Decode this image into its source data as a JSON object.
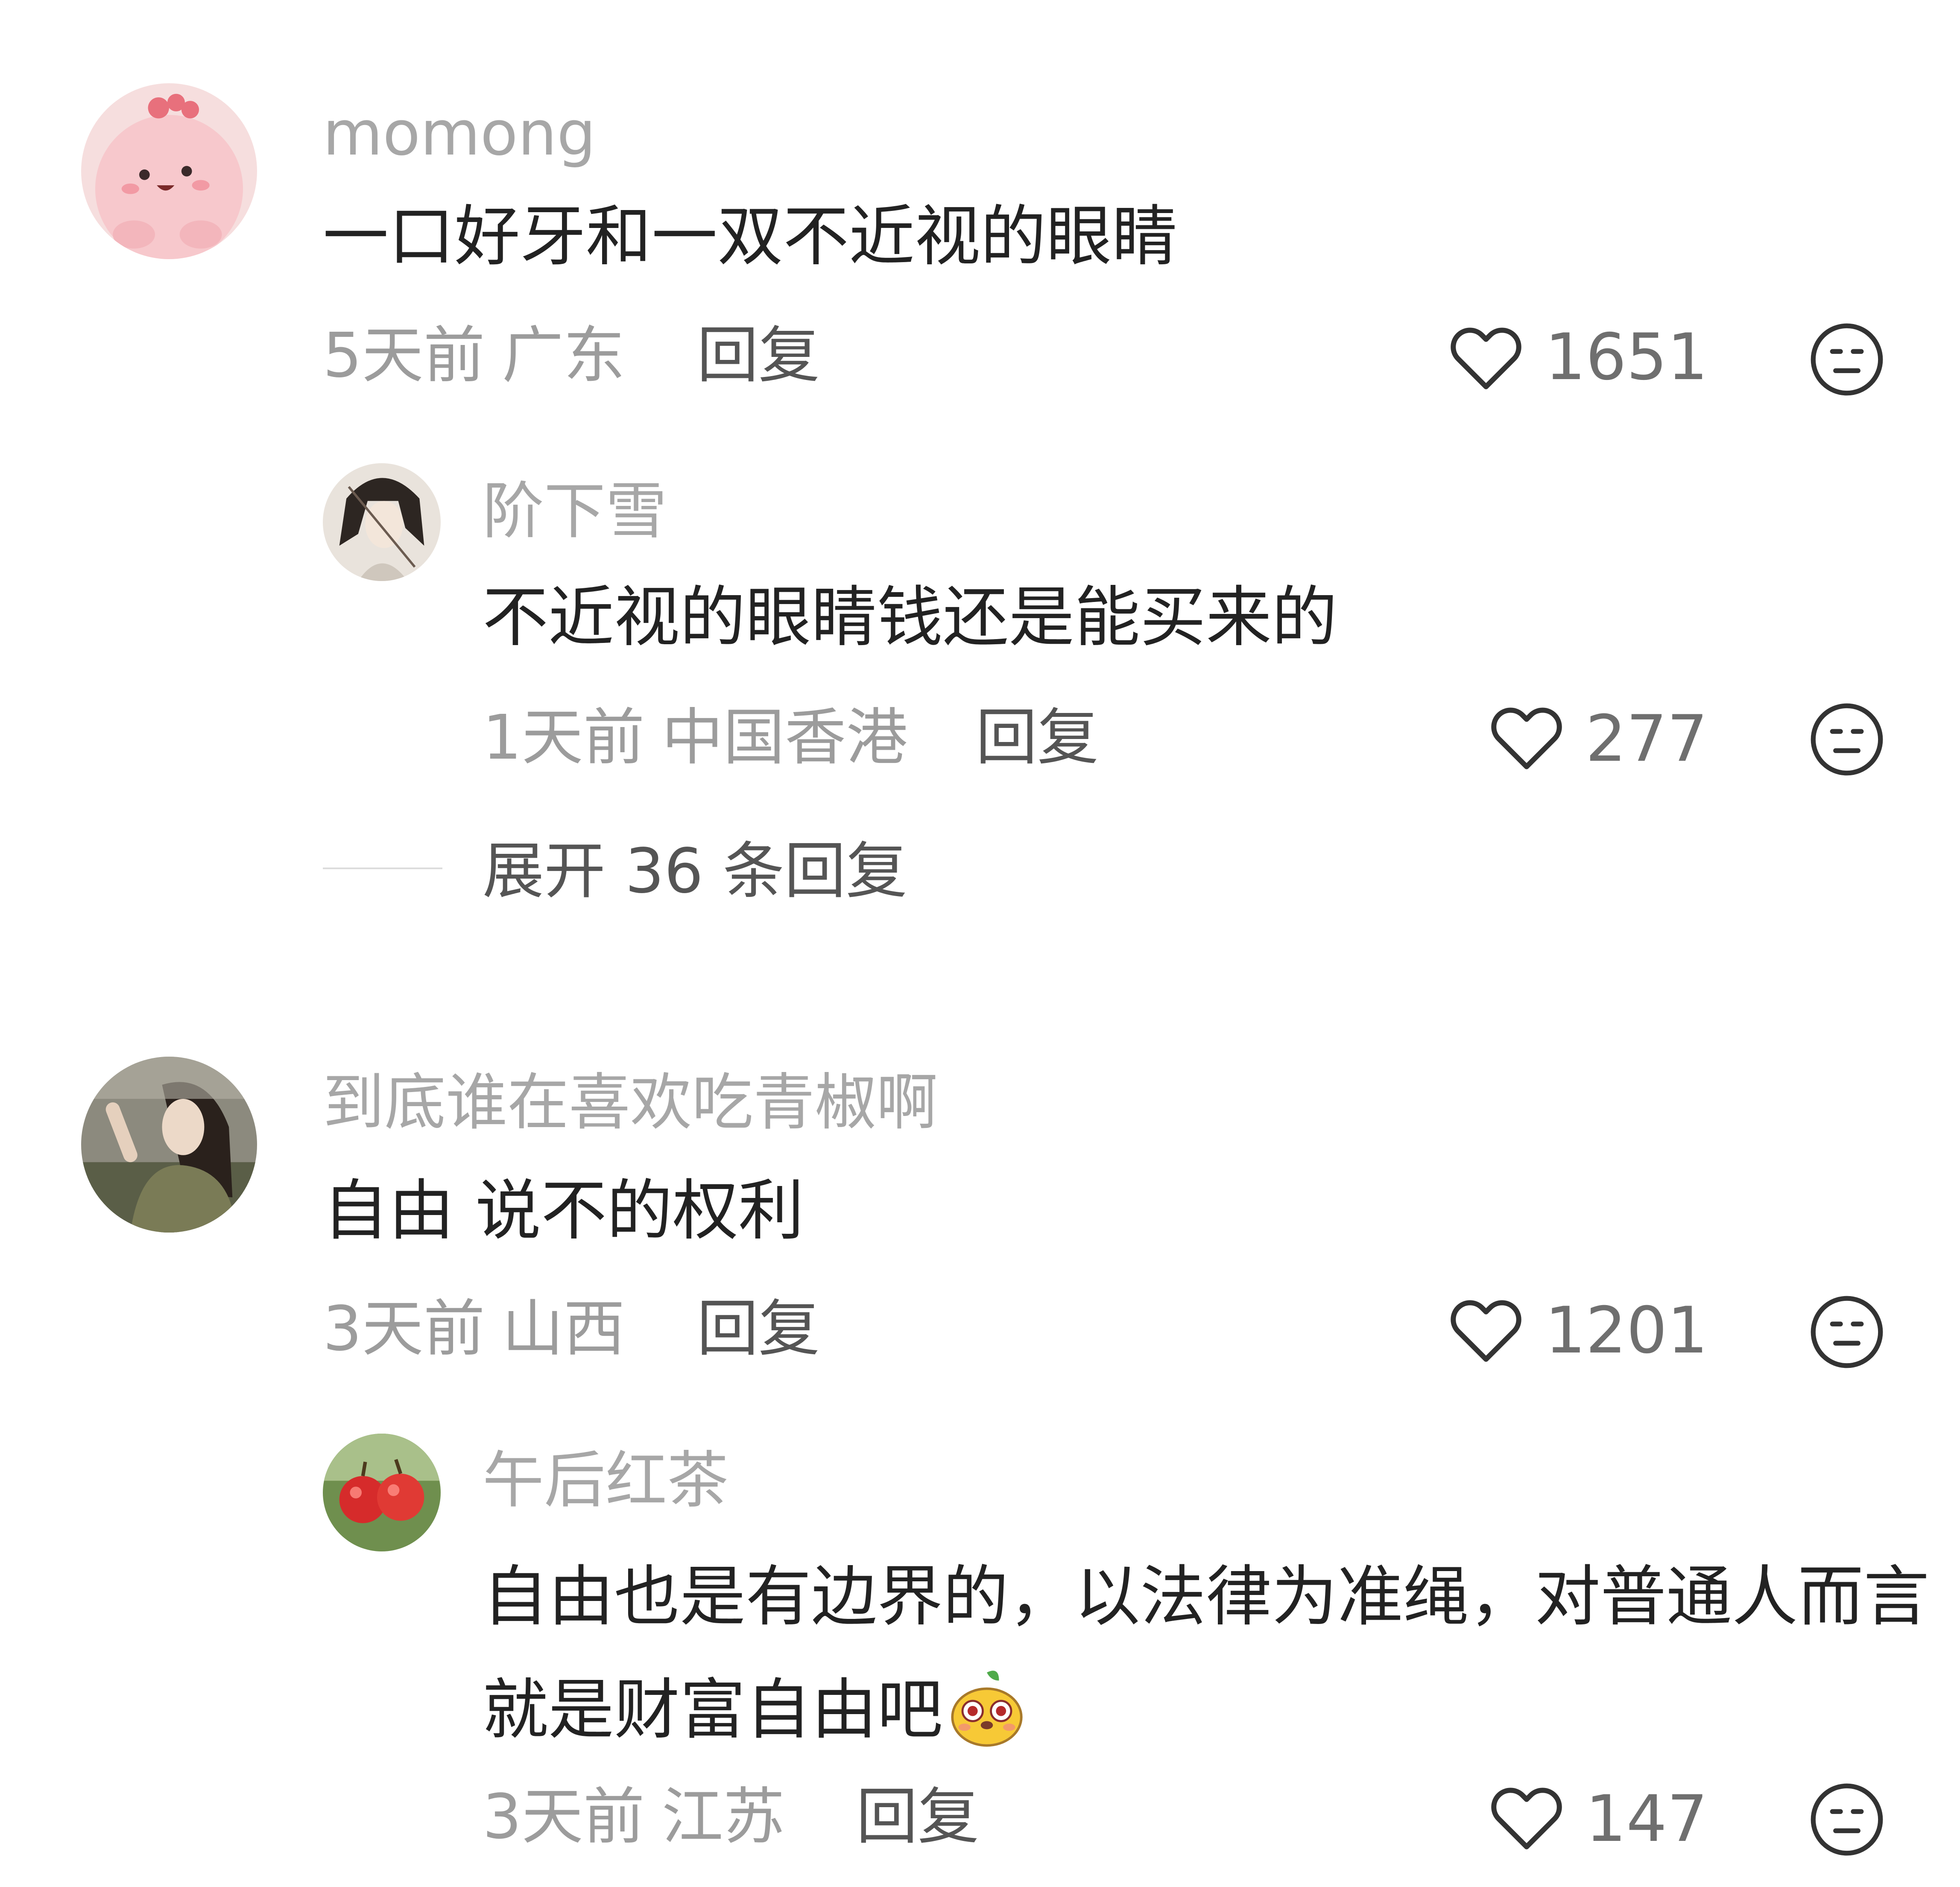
{
  "comments": [
    {
      "username": "momong",
      "content": "一口好牙和一双不近视的眼睛",
      "time": "5天前",
      "location": "广东",
      "reply_label": "回复",
      "likes": "1651",
      "replies": [
        {
          "username": "阶下雪",
          "content": "不近视的眼睛钱还是能买来的",
          "time": "1天前",
          "location": "中国香港",
          "reply_label": "回复",
          "likes": "277"
        }
      ],
      "expand_label": "展开 36 条回复"
    },
    {
      "username": "到底谁在喜欢吃青椒啊",
      "content": "自由 说不的权利",
      "time": "3天前",
      "location": "山西",
      "reply_label": "回复",
      "likes": "1201",
      "replies": [
        {
          "username": "午后红茶",
          "content": "自由也是有边界的，以法律为准绳，对普通人而言就是财富自由吧",
          "time": "3天前",
          "location": "江苏",
          "reply_label": "回复",
          "likes": "147"
        }
      ]
    }
  ],
  "icons": {
    "like": "heart-outline-icon",
    "dislike": "meh-face-icon",
    "emoji": "yellow-creature-emoji"
  },
  "colors": {
    "background": "#ffffff",
    "username": "#a7a7a7",
    "content": "#222222",
    "meta": "#9c9c9c",
    "reply": "#555555"
  }
}
